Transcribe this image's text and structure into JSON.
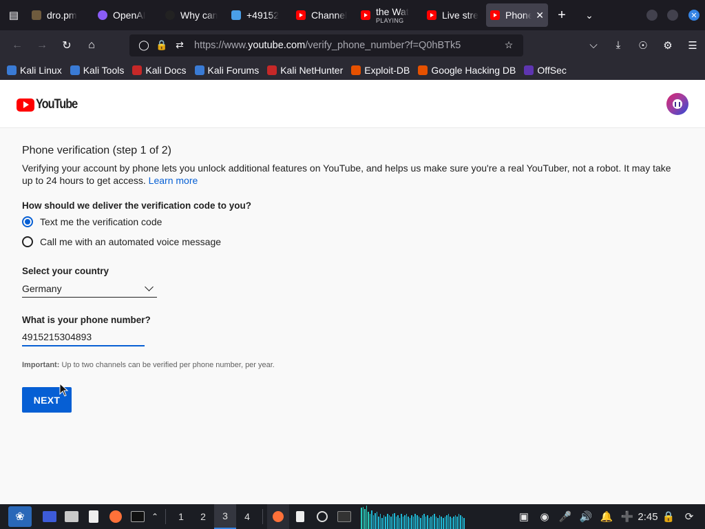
{
  "browser": {
    "tabs": [
      {
        "title": "dro.pm",
        "favicon": "page-icon",
        "color": "#6f5b3e",
        "sub": ""
      },
      {
        "title": "OpenAI",
        "favicon": "openai-icon",
        "color": "#8a5cf6",
        "sub": ""
      },
      {
        "title": "Why can",
        "favicon": "openai-icon",
        "color": "#222222",
        "sub": ""
      },
      {
        "title": "+49152",
        "favicon": "phone-icon",
        "color": "#4a9fe8",
        "sub": ""
      },
      {
        "title": "Channel",
        "favicon": "youtube-icon",
        "color": "#ff0000",
        "sub": ""
      },
      {
        "title": "the Wat",
        "favicon": "youtube-icon",
        "color": "#ff0000",
        "sub": "PLAYING"
      },
      {
        "title": "Live stre",
        "favicon": "youtube-icon",
        "color": "#ff0000",
        "sub": ""
      },
      {
        "title": "Phone",
        "favicon": "youtube-icon",
        "color": "#ff0000",
        "sub": "",
        "active": true
      }
    ],
    "url_prefix": "https://www.",
    "url_domain": "youtube.com",
    "url_path": "/verify_phone_number?f=Q0hBTk5",
    "bookmarks": [
      {
        "label": "Kali Linux",
        "color": "#3a7bd5"
      },
      {
        "label": "Kali Tools",
        "color": "#3a7bd5"
      },
      {
        "label": "Kali Docs",
        "color": "#c62828"
      },
      {
        "label": "Kali Forums",
        "color": "#3a7bd5"
      },
      {
        "label": "Kali NetHunter",
        "color": "#c62828"
      },
      {
        "label": "Exploit-DB",
        "color": "#e65100"
      },
      {
        "label": "Google Hacking DB",
        "color": "#e65100"
      },
      {
        "label": "OffSec",
        "color": "#5e35b1"
      }
    ]
  },
  "page": {
    "logo_text": "YouTube",
    "title": "Phone verification (step 1 of 2)",
    "description": "Verifying your account by phone lets you unlock additional features on YouTube, and helps us make sure you're a real YouTuber, not a robot. It may take up to 24 hours to get access.",
    "learn_more": "Learn more",
    "delivery_question": "How should we deliver the verification code to you?",
    "option_text": "Text me the verification code",
    "option_call": "Call me with an automated voice message",
    "selected_option": "text",
    "country_label": "Select your country",
    "country_value": "Germany",
    "phone_label": "What is your phone number?",
    "phone_value": "4915215304893",
    "note_bold": "Important:",
    "note_text": "Up to two channels can be verified per phone number, per year.",
    "next_label": "NEXT",
    "accent_color": "#065fd4"
  },
  "taskbar": {
    "workspaces": [
      "1",
      "2",
      "3",
      "4"
    ],
    "active_workspace": "3",
    "clock": "2:45",
    "visualizer_levels": [
      0.85,
      0.9,
      0.8,
      0.95,
      0.7,
      0.6,
      0.75,
      0.55,
      0.65,
      0.7,
      0.5,
      0.6,
      0.45,
      0.55,
      0.5,
      0.6,
      0.55,
      0.5,
      0.6,
      0.65,
      0.5,
      0.55,
      0.45,
      0.6,
      0.5,
      0.55,
      0.6,
      0.5,
      0.45,
      0.55,
      0.5,
      0.6,
      0.55,
      0.5,
      0.45,
      0.55,
      0.6,
      0.5,
      0.55,
      0.45,
      0.5,
      0.55,
      0.6,
      0.5,
      0.45,
      0.55,
      0.5,
      0.45,
      0.5,
      0.55,
      0.6,
      0.5,
      0.45,
      0.5,
      0.55,
      0.5,
      0.6,
      0.55,
      0.5,
      0.45
    ]
  }
}
